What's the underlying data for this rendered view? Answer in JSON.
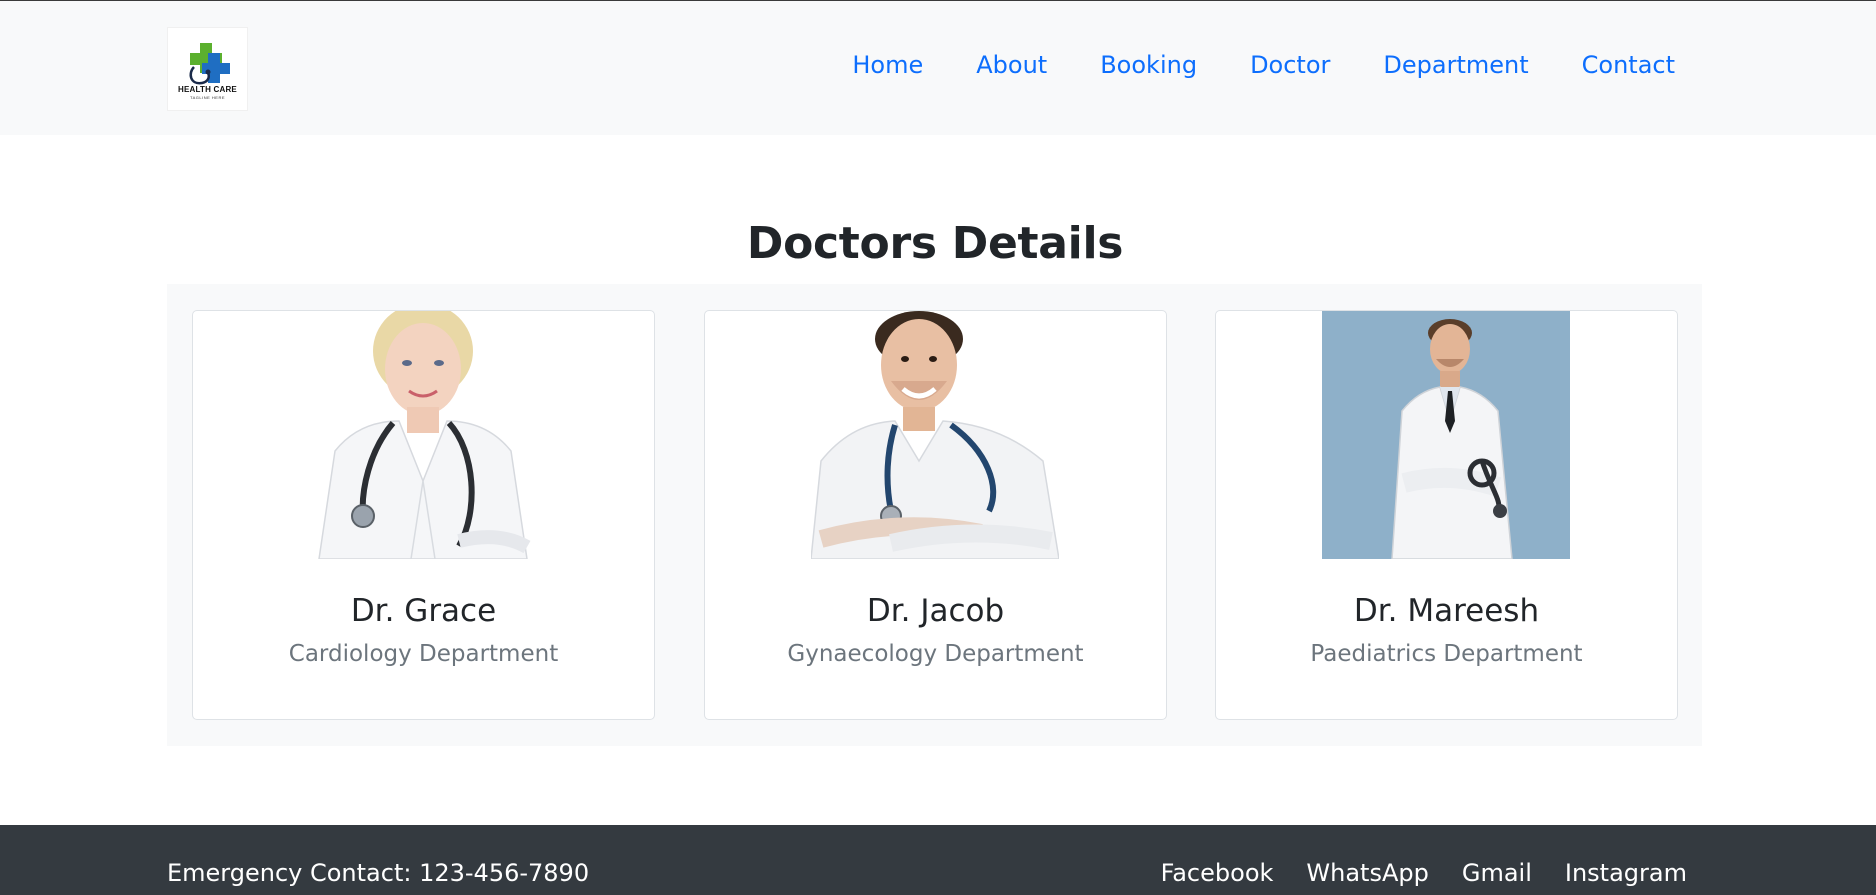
{
  "brand": {
    "logo_title": "HEALTH CARE",
    "logo_subtitle": "TAGLINE HERE",
    "colors": {
      "cross_green": "#5bb02e",
      "cross_blue": "#1f6ec2"
    }
  },
  "nav": {
    "items": [
      {
        "label": "Home"
      },
      {
        "label": "About"
      },
      {
        "label": "Booking"
      },
      {
        "label": "Doctor"
      },
      {
        "label": "Department"
      },
      {
        "label": "Contact"
      }
    ],
    "link_color": "#0d6efd"
  },
  "main": {
    "title": "Doctors Details",
    "doctors": [
      {
        "name": "Dr. Grace",
        "department": "Cardiology Department",
        "photo": "doctor-photo-female"
      },
      {
        "name": "Dr. Jacob",
        "department": "Gynaecology Department",
        "photo": "doctor-photo-male"
      },
      {
        "name": "Dr. Mareesh",
        "department": "Paediatrics Department",
        "photo": "doctor-photo-male-blue-bg"
      }
    ]
  },
  "footer": {
    "emergency": "Emergency Contact: 123-456-7890",
    "links": [
      {
        "label": "Facebook"
      },
      {
        "label": "WhatsApp"
      },
      {
        "label": "Gmail"
      },
      {
        "label": "Instagram"
      }
    ],
    "background": "#343a40"
  }
}
